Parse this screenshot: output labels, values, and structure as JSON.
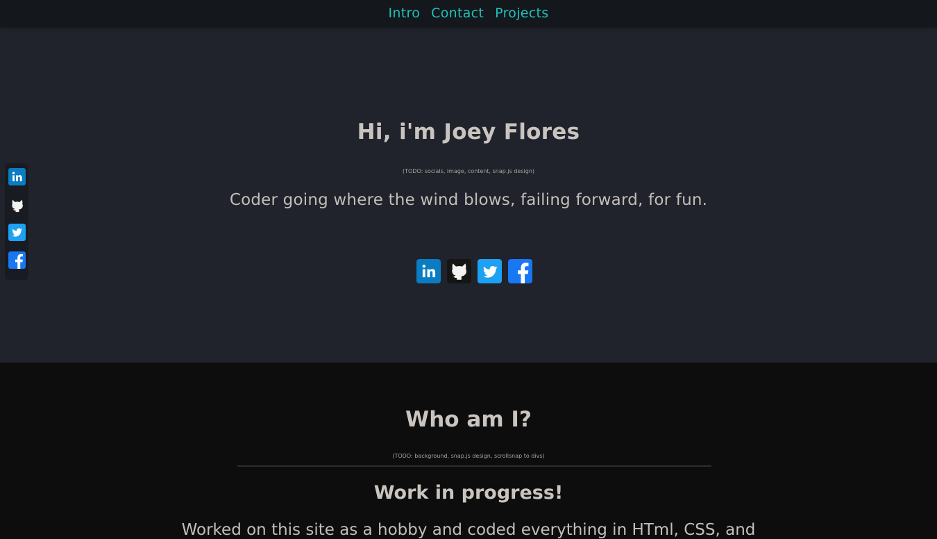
{
  "nav": {
    "links": [
      "Intro",
      "Contact",
      "Projects"
    ]
  },
  "hero": {
    "title": "Hi, i'm Joey Flores",
    "todo_note": "(TODO: socials, image, content, snap.js design)",
    "tagline": "Coder going where the wind blows, failing forward, for fun."
  },
  "socials": [
    {
      "icon": "linkedin-icon",
      "color": "#0a7cc1"
    },
    {
      "icon": "github-icon",
      "color": "#151515"
    },
    {
      "icon": "twitter-icon",
      "color": "#1da1f2"
    },
    {
      "icon": "facebook-icon",
      "color": "#1877f2"
    }
  ],
  "about": {
    "title": "Who am I?",
    "todo_note": "(TODO: background, snap.js design, scrollsnap to divs)",
    "subtitle": "Work in progress!",
    "body": "Worked on this site as a hobby and coded everything in HTml, CSS, and"
  },
  "colors": {
    "accent": "#1fc3b8",
    "hero_bg": "#20232b",
    "about_bg": "#0d0d0d",
    "nav_bg": "#14171c",
    "text": "#c9c4bf"
  }
}
